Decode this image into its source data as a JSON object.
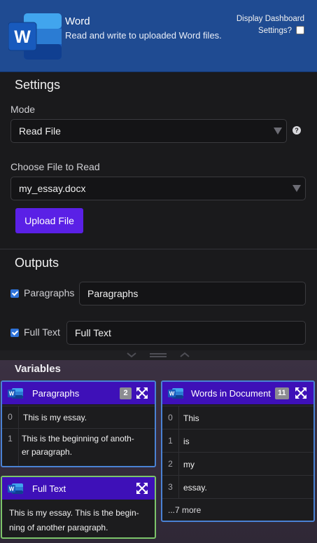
{
  "header": {
    "app_name": "Word",
    "description": "Read and write to uploaded Word files.",
    "dashboard_label": "Display Dashboard",
    "dashboard_label_2": "Settings?",
    "dashboard_checked": false,
    "brand_color": "#1f4b92"
  },
  "settings": {
    "title": "Settings",
    "mode_label": "Mode",
    "mode_value": "Read File",
    "help_icon": "?",
    "file_label": "Choose File to Read",
    "file_value": "my_essay.docx",
    "upload_label": "Upload File",
    "accent_color": "#5a20e6"
  },
  "outputs": {
    "title": "Outputs",
    "items": [
      {
        "label": "Paragraphs",
        "value": "Paragraphs",
        "checked": true
      },
      {
        "label": "Full Text",
        "value": "Full Text",
        "checked": true
      }
    ]
  },
  "variables": {
    "title": "Variables",
    "paragraphs": {
      "title": "Paragraphs",
      "count": "2",
      "rows": [
        {
          "index": "0",
          "line1": "This is my essay.",
          "line2": ""
        },
        {
          "index": "1",
          "line1": "This is the beginning of anoth-",
          "line2": "er paragraph."
        }
      ],
      "border_color": "#4a82d4"
    },
    "full_text": {
      "title": "Full Text",
      "line1": "This is my essay. This is the begin-",
      "line2": "ning of another paragraph.",
      "border_color": "#7cc46a"
    },
    "words": {
      "title": "Words in Document",
      "count": "11",
      "rows": [
        {
          "index": "0",
          "value": "This"
        },
        {
          "index": "1",
          "value": "is"
        },
        {
          "index": "2",
          "value": "my"
        },
        {
          "index": "3",
          "value": "essay."
        }
      ],
      "more": "...7 more",
      "border_color": "#4a82d4"
    }
  }
}
